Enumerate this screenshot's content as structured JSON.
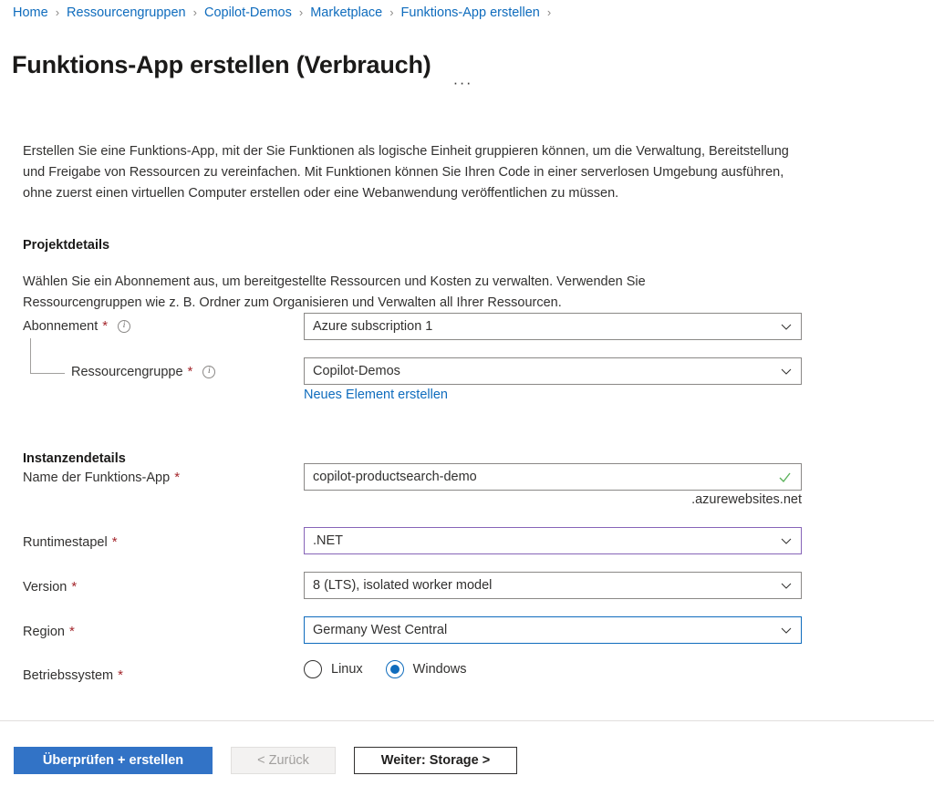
{
  "breadcrumb": {
    "separator": "›",
    "items": [
      {
        "label": "Home"
      },
      {
        "label": "Ressourcengruppen"
      },
      {
        "label": "Copilot-Demos"
      },
      {
        "label": "Marketplace"
      },
      {
        "label": "Funktions-App erstellen"
      }
    ]
  },
  "header": {
    "title": "Funktions-App erstellen (Verbrauch)",
    "more_actions": "···"
  },
  "intro": {
    "text": "Erstellen Sie eine Funktions-App, mit der Sie Funktionen als logische Einheit gruppieren können, um die Verwaltung, Bereitstellung und Freigabe von Ressourcen zu vereinfachen. Mit Funktionen können Sie Ihren Code in einer serverlosen Umgebung ausführen, ohne zuerst einen virtuellen Computer erstellen oder eine Webanwendung veröffentlichen zu müssen."
  },
  "project_details": {
    "heading": "Projektdetails",
    "description": "Wählen Sie ein Abonnement aus, um bereitgestellte Ressourcen und Kosten zu verwalten. Verwenden Sie Ressourcengruppen wie z. B. Ordner zum Organisieren und Verwalten all Ihrer Ressourcen.",
    "subscription": {
      "label": "Abonnement",
      "required_marker": "*",
      "info_glyph": "i",
      "value": "Azure subscription 1"
    },
    "resource_group": {
      "label": "Ressourcengruppe",
      "required_marker": "*",
      "info_glyph": "i",
      "value": "Copilot-Demos",
      "create_new_link": "Neues Element erstellen"
    }
  },
  "instance_details": {
    "heading": "Instanzendetails",
    "app_name": {
      "label": "Name der Funktions-App",
      "required_marker": "*",
      "value": "copilot-productsearch-demo",
      "suffix": ".azurewebsites.net",
      "validation_state": "valid"
    },
    "runtime_stack": {
      "label": "Runtimestapel",
      "required_marker": "*",
      "value": ".NET"
    },
    "version": {
      "label": "Version",
      "required_marker": "*",
      "value": "8 (LTS), isolated worker model"
    },
    "region": {
      "label": "Region",
      "required_marker": "*",
      "value": "Germany West Central"
    },
    "operating_system": {
      "label": "Betriebssystem",
      "required_marker": "*",
      "options": [
        {
          "label": "Linux",
          "selected": false
        },
        {
          "label": "Windows",
          "selected": true
        }
      ]
    }
  },
  "footer": {
    "review_create": "Überprüfen + erstellen",
    "previous": "< Zurück",
    "next": "Weiter: Storage >"
  },
  "colors": {
    "link": "#0f6cbd",
    "primary_button": "#3273c6",
    "required_asterisk": "#a4262c",
    "field_border": "#8a8886",
    "field_border_changed": "#8764b8",
    "field_border_focus": "#0f6cbd",
    "valid_check": "#5bb25b"
  }
}
